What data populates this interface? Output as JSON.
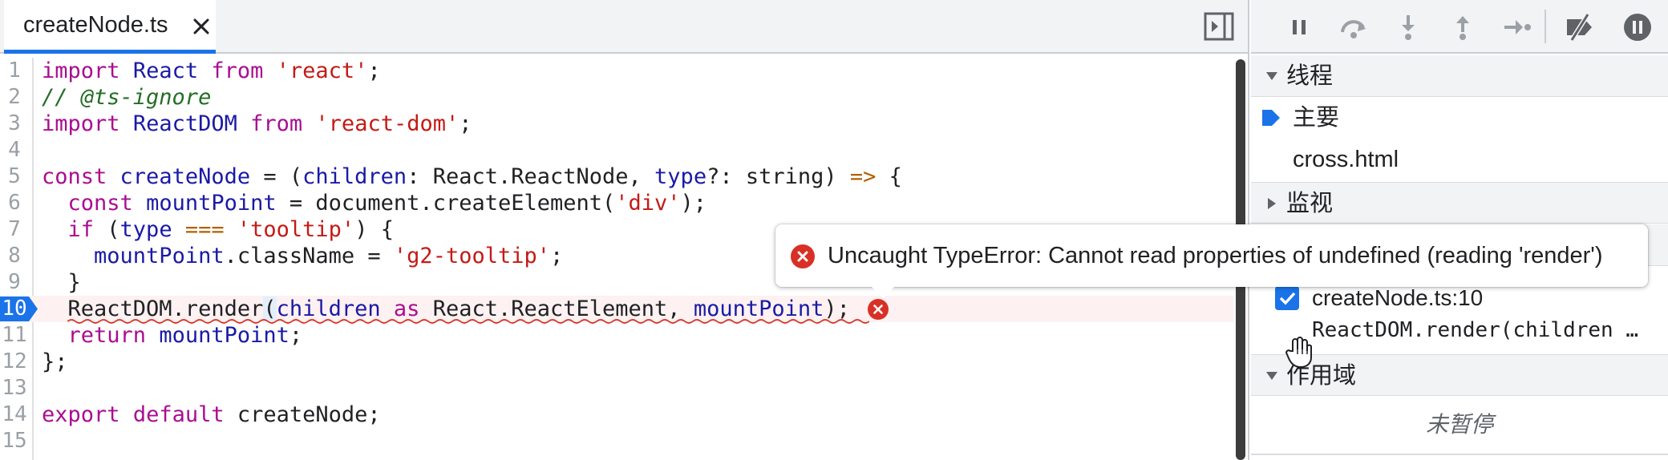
{
  "editor": {
    "tab": {
      "label": "createNode.ts",
      "close_glyph": "✕"
    },
    "lines": [
      {
        "num": "1"
      },
      {
        "num": "2"
      },
      {
        "num": "3"
      },
      {
        "num": "4"
      },
      {
        "num": "5"
      },
      {
        "num": "6"
      },
      {
        "num": "7"
      },
      {
        "num": "8"
      },
      {
        "num": "9"
      },
      {
        "num": "10"
      },
      {
        "num": "11"
      },
      {
        "num": "12"
      },
      {
        "num": "13"
      },
      {
        "num": "14"
      },
      {
        "num": "15"
      }
    ],
    "code": {
      "l1": [
        "import",
        " ",
        "React",
        " ",
        "from",
        " ",
        "'react'",
        ";"
      ],
      "l2": "// @ts-ignore",
      "l3": [
        "import",
        " ",
        "ReactDOM",
        " ",
        "from",
        " ",
        "'react-dom'",
        ";"
      ],
      "l5": [
        "const",
        " ",
        "createNode",
        " = (",
        "children",
        ": React.ReactNode, ",
        "type",
        "?: string) ",
        "=>",
        " {"
      ],
      "l6": [
        "  ",
        "const",
        " ",
        "mountPoint",
        " = document.createElement(",
        "'div'",
        ");"
      ],
      "l7": [
        "  ",
        "if",
        " (",
        "type",
        " ",
        "===",
        " ",
        "'tooltip'",
        ") {"
      ],
      "l8": [
        "    ",
        "mountPoint",
        ".className = ",
        "'g2-tooltip'",
        ";"
      ],
      "l9": "  }",
      "l10": [
        "  ReactDOM.render",
        "(",
        "children",
        " ",
        "as",
        " React.ReactElement, ",
        "mountPoint",
        ");"
      ],
      "l11": [
        "  ",
        "return",
        " ",
        "mountPoint",
        ";"
      ],
      "l12": "};",
      "l14": [
        "export",
        " ",
        "default",
        " createNode;"
      ]
    },
    "error_tooltip": "Uncaught TypeError: Cannot read properties of undefined (reading 'render')"
  },
  "debugger": {
    "sections": {
      "threads": "线程",
      "watch": "监视",
      "scope": "作用域"
    },
    "threads": [
      {
        "label": "主要",
        "active": true
      },
      {
        "label": "cross.html",
        "active": false
      }
    ],
    "breakpoint": {
      "file": "createNode.ts:10",
      "snippet": "ReactDOM.render(children …"
    },
    "scope_status": "未暂停"
  },
  "colors": {
    "accent": "#1a73e8",
    "error": "#d93025",
    "keyword": "#aa0d91",
    "string": "#c41a16",
    "comment": "#236e25"
  }
}
